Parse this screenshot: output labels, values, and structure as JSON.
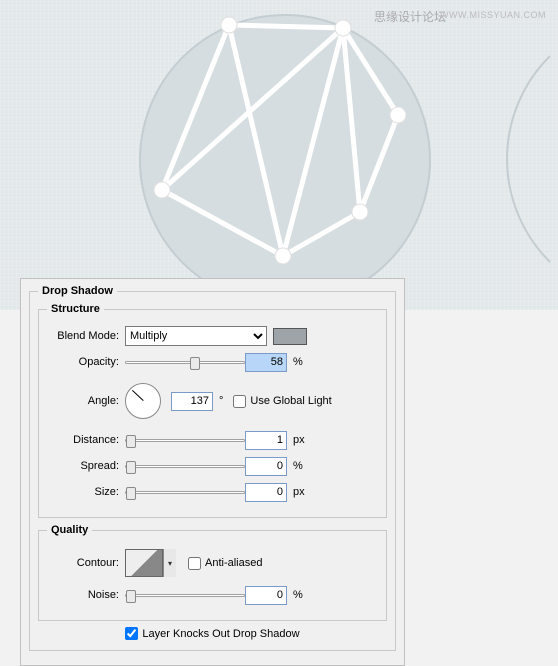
{
  "watermark": {
    "cn": "思缘设计论坛",
    "en": "WWW.MISSYUAN.COM"
  },
  "panel": {
    "title": "Drop Shadow",
    "structure": {
      "legend": "Structure",
      "blend_mode_label": "Blend Mode:",
      "blend_mode_value": "Multiply",
      "opacity_label": "Opacity:",
      "opacity_value": "58",
      "opacity_unit": "%",
      "angle_label": "Angle:",
      "angle_value": "137",
      "angle_unit": "°",
      "use_global_label": "Use Global Light",
      "use_global_checked": false,
      "distance_label": "Distance:",
      "distance_value": "1",
      "distance_unit": "px",
      "spread_label": "Spread:",
      "spread_value": "0",
      "spread_unit": "%",
      "size_label": "Size:",
      "size_value": "0",
      "size_unit": "px"
    },
    "quality": {
      "legend": "Quality",
      "contour_label": "Contour:",
      "antialiased_label": "Anti-aliased",
      "antialiased_checked": false,
      "noise_label": "Noise:",
      "noise_value": "0",
      "noise_unit": "%"
    },
    "knockout_label": "Layer Knocks Out Drop Shadow",
    "knockout_checked": true
  }
}
